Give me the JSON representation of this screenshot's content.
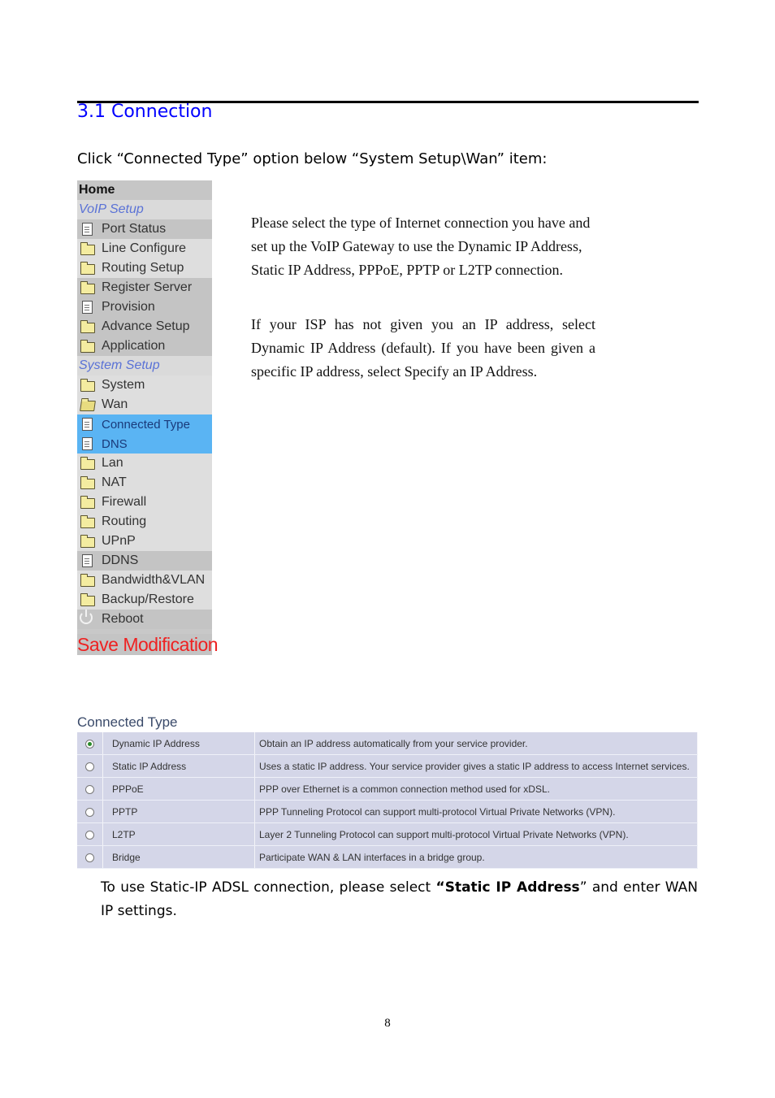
{
  "heading": "3.1 Connection",
  "intro": "Click “Connected Type” option below “System Setup\\Wan” item:",
  "menu": {
    "items": [
      {
        "label": "Home",
        "kind": "home",
        "icon": ""
      },
      {
        "label": "VoIP Setup",
        "kind": "section",
        "icon": ""
      },
      {
        "label": "Port Status",
        "kind": "dark",
        "icon": "document-icon"
      },
      {
        "label": "Line Configure",
        "kind": "light",
        "icon": "folder-icon"
      },
      {
        "label": "Routing Setup",
        "kind": "light",
        "icon": "folder-icon"
      },
      {
        "label": "Register Server",
        "kind": "dark",
        "icon": "folder-icon"
      },
      {
        "label": "Provision",
        "kind": "dark",
        "icon": "document-icon"
      },
      {
        "label": "Advance Setup",
        "kind": "dark",
        "icon": "folder-icon"
      },
      {
        "label": "Application",
        "kind": "dark",
        "icon": "folder-icon"
      },
      {
        "label": "System Setup",
        "kind": "section",
        "icon": ""
      },
      {
        "label": "System",
        "kind": "light",
        "icon": "folder-icon"
      },
      {
        "label": "Wan",
        "kind": "light",
        "icon": "folder-open-icon"
      },
      {
        "label": "Connected Type",
        "kind": "sel",
        "icon": "document-icon"
      },
      {
        "label": "DNS",
        "kind": "sel",
        "icon": "document-icon"
      },
      {
        "label": "Lan",
        "kind": "light",
        "icon": "folder-icon"
      },
      {
        "label": "NAT",
        "kind": "light",
        "icon": "folder-icon"
      },
      {
        "label": "Firewall",
        "kind": "light",
        "icon": "folder-icon"
      },
      {
        "label": "Routing",
        "kind": "light",
        "icon": "folder-icon"
      },
      {
        "label": "UPnP",
        "kind": "light",
        "icon": "folder-icon"
      },
      {
        "label": "DDNS",
        "kind": "dark",
        "icon": "document-icon"
      },
      {
        "label": "Bandwidth&VLAN",
        "kind": "light",
        "icon": "folder-icon"
      },
      {
        "label": "Backup/Restore",
        "kind": "light",
        "icon": "folder-icon"
      },
      {
        "label": "Reboot",
        "kind": "dark",
        "icon": "power-icon"
      }
    ],
    "save_label": "Save Modification",
    "colors": {
      "selected": "#5ab4f3",
      "section_text": "#5a72d6",
      "save_text": "#ee2222"
    }
  },
  "description": {
    "p1": "Please select the type of Internet connection you have and set up the VoIP Gateway to use the Dynamic IP Address, Static IP Address, PPPoE, PPTP or L2TP connection.",
    "p2": "If your ISP has not given you an IP address, select Dynamic IP Address (default). If you have been given a specific IP address, select Specify an IP Address."
  },
  "connected_type": {
    "title": "Connected Type",
    "rows": [
      {
        "name": "Dynamic IP Address",
        "desc": "Obtain an IP address automatically from your service provider.",
        "selected": true
      },
      {
        "name": "Static IP Address",
        "desc": "Uses a static IP address. Your service provider gives a static IP address to access Internet services.",
        "selected": false
      },
      {
        "name": "PPPoE",
        "desc": "PPP over Ethernet is a common connection method used for xDSL.",
        "selected": false
      },
      {
        "name": "PPTP",
        "desc": "PPP Tunneling Protocol can support multi-protocol Virtual Private Networks (VPN).",
        "selected": false
      },
      {
        "name": "L2TP",
        "desc": "Layer 2 Tunneling Protocol can support multi-protocol Virtual Private Networks (VPN).",
        "selected": false
      },
      {
        "name": "Bridge",
        "desc": "Participate WAN & LAN interfaces in a bridge group.",
        "selected": false
      }
    ]
  },
  "outro": {
    "before": "To use Static-IP ADSL connection, please select ",
    "bold": "“Static IP Address",
    "after": "” and enter WAN IP settings."
  },
  "page_number": "8"
}
